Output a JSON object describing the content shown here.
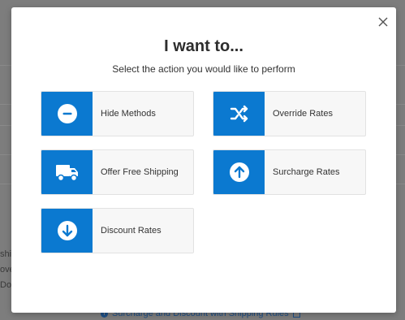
{
  "modal": {
    "title": "I want to...",
    "subtitle": "Select the action you would like to perform",
    "close_icon": "close-icon",
    "accent_color": "#0b79d0",
    "options": [
      {
        "label": "Hide Methods",
        "icon": "minus-circle-icon"
      },
      {
        "label": "Override Rates",
        "icon": "shuffle-icon"
      },
      {
        "label": "Offer Free Shipping",
        "icon": "truck-icon"
      },
      {
        "label": "Surcharge Rates",
        "icon": "arrow-up-circle-icon"
      },
      {
        "label": "Discount Rates",
        "icon": "arrow-down-circle-icon"
      }
    ]
  },
  "background": {
    "fragments": [
      "shi",
      "ove",
      "Doc"
    ],
    "link_text": "Surcharge and Discount with Shipping Rules"
  }
}
